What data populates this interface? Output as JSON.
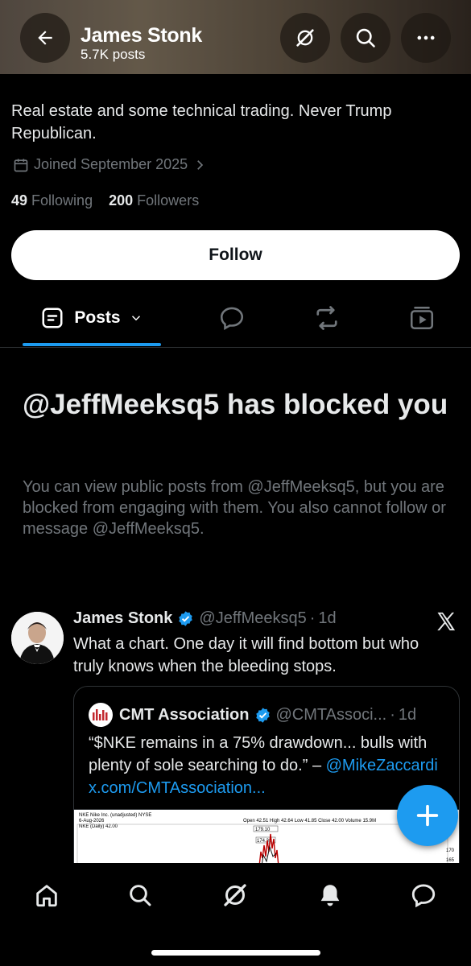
{
  "header": {
    "title": "James Stonk",
    "subtitle": "5.7K posts"
  },
  "profile": {
    "bio": "Real estate and some technical trading. Never Trump Republican.",
    "joined": "Joined September 2025",
    "following_count": "49",
    "following_label": "Following",
    "followers_count": "200",
    "followers_label": "Followers",
    "follow_label": "Follow"
  },
  "tabs": {
    "posts_label": "Posts"
  },
  "blocked": {
    "title": "@JeffMeeksq5 has blocked you",
    "description": "You can view public posts from @JeffMeeksq5, but you are blocked from engaging with them. You also cannot follow or message @JeffMeeksq5."
  },
  "tweet": {
    "name": "James Stonk",
    "handle": "@JeffMeeksq5",
    "separator": "·",
    "time": "1d",
    "text": "What a chart. One day it will find bottom but who truly knows when the bleeding stops."
  },
  "quote": {
    "name": "CMT Association",
    "handle": "@CMTAssoci...",
    "separator": "·",
    "time": "1d",
    "text": "“$NKE remains in a 75% drawdown... bulls with plenty of sole searching to do.” –",
    "mention": "@MikeZaccardi",
    "link": "x.com/CMTAssociation...",
    "chart_label": "NKE Nike Inc. (unadjusted) NYSE",
    "chart_date": "6-Aug-2026",
    "chart_series": "NKE (Daily) 42.00",
    "chart_ohlc": "Open 42.51  High 42.64  Low 41.85  Close 42.00  Volume 15.9M",
    "chart_tag1": "179.10",
    "chart_tag2": "174.38",
    "chart_axis": [
      "170",
      "165"
    ]
  },
  "colors": {
    "accent": "#1d9bf0",
    "muted": "#71767b",
    "background": "#000000"
  },
  "icons": {
    "back": "arrow-left-icon",
    "grok": "grok-icon",
    "search": "search-icon",
    "more": "more-icon"
  }
}
